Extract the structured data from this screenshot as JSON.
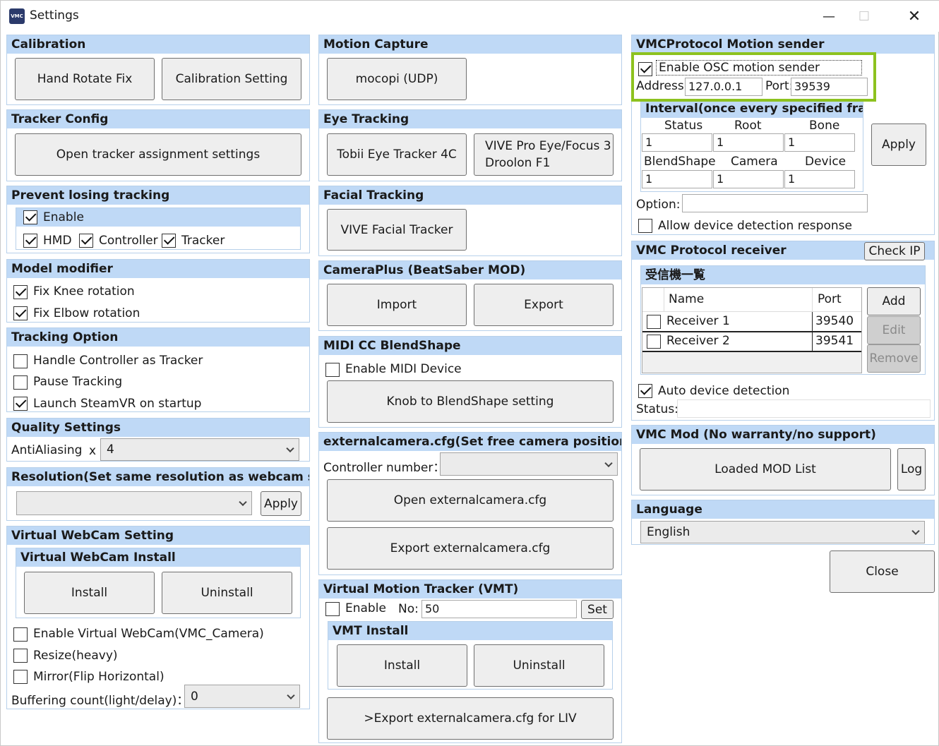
{
  "window": {
    "title": "Settings",
    "app_icon_text": "VMC",
    "minimize": "—",
    "maximize": "☐",
    "close": "✕"
  },
  "calibration": {
    "header": "Calibration",
    "hand_rotate_fix": "Hand Rotate Fix",
    "calibration_setting": "Calibration Setting"
  },
  "tracker_config": {
    "header": "Tracker Config",
    "open_assignment": "Open tracker assignment settings"
  },
  "prevent_losing": {
    "header": "Prevent losing tracking",
    "enable": "Enable",
    "hmd": "HMD",
    "controller": "Controller",
    "tracker": "Tracker"
  },
  "model_modifier": {
    "header": "Model modifier",
    "fix_knee": "Fix Knee rotation",
    "fix_elbow": "Fix Elbow rotation"
  },
  "tracking_option": {
    "header": "Tracking Option",
    "handle_controller": "Handle Controller as Tracker",
    "pause_tracking": "Pause Tracking",
    "launch_steamvr": "Launch SteamVR on startup"
  },
  "quality": {
    "header": "Quality Settings",
    "antialiasing_label": "AntiAliasing",
    "x_label": "x",
    "antialiasing_value": "4"
  },
  "resolution": {
    "header": "Resolution(Set same resolution as webcam settin",
    "value": "",
    "apply": "Apply"
  },
  "virtual_webcam": {
    "header": "Virtual WebCam Setting",
    "install_header": "Virtual WebCam Install",
    "install": "Install",
    "uninstall": "Uninstall",
    "enable": "Enable Virtual WebCam(VMC_Camera)",
    "resize": "Resize(heavy)",
    "mirror": "Mirror(Flip Horizontal)",
    "buffering_label": "Buffering count(light/delay)：",
    "buffering_value": "0"
  },
  "motion_capture": {
    "header": "Motion Capture",
    "mocopi": "mocopi (UDP)"
  },
  "eye_tracking": {
    "header": "Eye Tracking",
    "tobii": "Tobii Eye Tracker 4C",
    "vive_pro_line1": "VIVE Pro Eye/Focus 3",
    "vive_pro_line2": "Droolon F1"
  },
  "facial_tracking": {
    "header": "Facial Tracking",
    "vive_facial": "VIVE Facial Tracker"
  },
  "cameraplus": {
    "header": "CameraPlus (BeatSaber MOD)",
    "import": "Import",
    "export": "Export"
  },
  "midi": {
    "header": "MIDI CC BlendShape",
    "enable": "Enable MIDI Device",
    "knob": "Knob to BlendShape setting"
  },
  "externalcamera": {
    "header": "externalcamera.cfg(Set free camera position)",
    "controller_number": "Controller number：",
    "controller_value": "",
    "open": "Open externalcamera.cfg",
    "export": "Export externalcamera.cfg"
  },
  "vmt": {
    "header": "Virtual Motion Tracker (VMT)",
    "enable": "Enable",
    "no_label": "No:",
    "no_value": "50",
    "set": "Set",
    "install_header": "VMT Install",
    "install": "Install",
    "uninstall": "Uninstall",
    "export_liv": ">Export externalcamera.cfg for LIV"
  },
  "sender": {
    "header": "VMCProtocol Motion sender",
    "enable_osc": "Enable OSC motion sender",
    "address_label": "Address:",
    "address_value": "127.0.0.1",
    "port_label": "Port:",
    "port_value": "39539",
    "interval_header": "Interval(once every specified frame",
    "status_label": "Status",
    "root_label": "Root",
    "bone_label": "Bone",
    "status_value": "1",
    "root_value": "1",
    "bone_value": "1",
    "blendshape_label": "BlendShape",
    "camera_label": "Camera",
    "device_label": "Device",
    "blendshape_value": "1",
    "camera_value": "1",
    "device_value": "1",
    "apply": "Apply",
    "option_label": "Option:",
    "option_value": "",
    "allow_detection": "Allow device detection response",
    "highlight_color": "#8dc21f"
  },
  "receiver": {
    "header": "VMC Protocol receiver",
    "check_ip": "Check IP",
    "list_header": "受信機一覧",
    "col_name": "Name",
    "col_port": "Port",
    "rows": [
      {
        "name": "Receiver 1",
        "port": "39540"
      },
      {
        "name": "Receiver 2",
        "port": "39541"
      }
    ],
    "add": "Add",
    "edit": "Edit",
    "remove": "Remove",
    "auto_detection": "Auto device detection",
    "status_label": "Status:",
    "status_value": ""
  },
  "vmc_mod": {
    "header": "VMC Mod (No warranty/no support)",
    "loaded_mod_list": "Loaded MOD List",
    "log": "Log"
  },
  "language": {
    "header": "Language",
    "value": "English"
  },
  "close_button": "Close",
  "colors": {
    "group_header": "#bfd9f6",
    "group_border": "#b7d0ea",
    "button_bg": "#eeeeee"
  }
}
